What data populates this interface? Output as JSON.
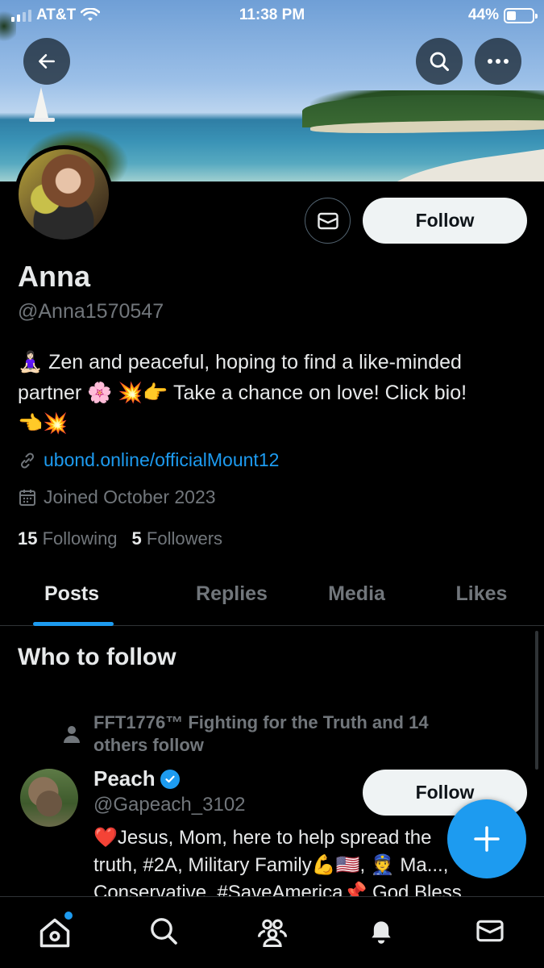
{
  "status_bar": {
    "carrier": "AT&T",
    "time": "11:38 PM",
    "battery": "44%",
    "battery_level": 0.44
  },
  "banner": {
    "back_icon": "arrow-left-icon",
    "search_icon": "search-icon",
    "more_icon": "more-icon"
  },
  "profile": {
    "name": "Anna",
    "handle": "@Anna1570547",
    "follow_label": "Follow",
    "bio_line1": "🧘🏻‍♀️ Zen and peaceful, hoping to find a like-minded",
    "bio_line2": "partner 🌸 💥👉 Take a chance on love! Click bio!",
    "bio_line3": "👈💥",
    "url": "ubond.online/officialMount12",
    "joined": "Joined October 2023",
    "following_count": "15",
    "following_label": "Following",
    "followers_count": "5",
    "followers_label": "Followers"
  },
  "tabs": [
    {
      "label": "Posts"
    },
    {
      "label": "Replies"
    },
    {
      "label": "Media"
    },
    {
      "label": "Likes"
    }
  ],
  "who_to_follow": {
    "title": "Who to follow",
    "social_context": "FFT1776™ Fighting for the Truth and 14 others follow",
    "name": "Peach",
    "handle": "@Gapeach_3102",
    "follow_label": "Follow",
    "bio_line1": "❤️Jesus, Mom, here to help spread the",
    "bio_line2": "truth, #2A, Military Family💪🇺🇸, 👮 Ma...,",
    "bio_line3": "Conservative, #SaveAmerica📌 God Bless"
  },
  "colors": {
    "accent": "#1d9bf0",
    "background": "#000000",
    "text_primary": "#e7e9ea",
    "text_secondary": "#71767b"
  }
}
